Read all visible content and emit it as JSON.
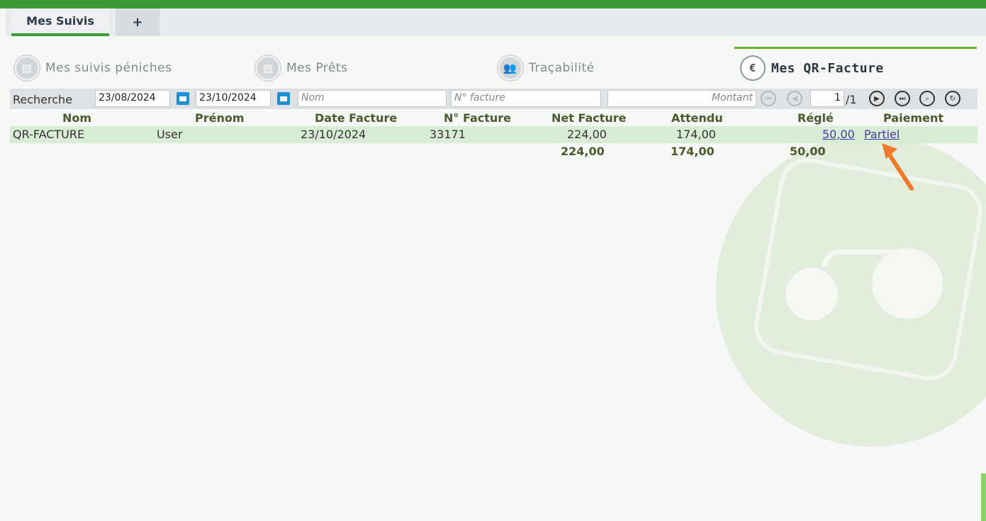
{
  "tabs": {
    "active": "Mes Suivis",
    "add": "+"
  },
  "nav": [
    {
      "label": "Mes suivis péniches",
      "icon": "document-icon"
    },
    {
      "label": "Mes Prêts",
      "icon": "document-icon"
    },
    {
      "label": "Traçabilité",
      "icon": "people-icon"
    },
    {
      "label": "Mes QR-Facture",
      "icon": "euro-people-icon"
    }
  ],
  "search": {
    "label": "Recherche",
    "date_from": "23/08/2024",
    "date_to": "23/10/2024",
    "name_placeholder": "Nom",
    "invoice_placeholder": "N° facture",
    "amount_placeholder": "Montant",
    "page_value": "1",
    "page_total": "/1"
  },
  "table": {
    "headers": [
      "Nom",
      "Prénom",
      "Date Facture",
      "N° Facture",
      "Net Facture",
      "Attendu",
      "Réglé",
      "Paiement"
    ],
    "rows": [
      {
        "nom": "QR-FACTURE",
        "prenom": "User",
        "date": "23/10/2024",
        "numero": "33171",
        "net": "224,00",
        "attendu": "174,00",
        "regle": "50,00",
        "paiement": "Partiel"
      }
    ],
    "totals": {
      "net": "224,00",
      "attendu": "174,00",
      "regle": "50,00"
    }
  },
  "colors": {
    "brand": "#3a9a35",
    "accent": "#6ab334",
    "link": "#4a3ba0",
    "arrow": "#f07a2a"
  }
}
